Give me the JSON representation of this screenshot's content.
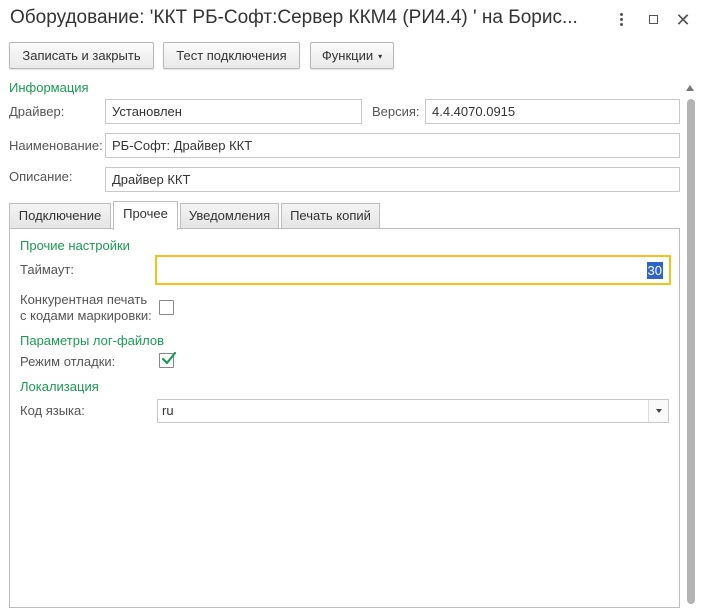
{
  "window": {
    "title": "Оборудование: 'ККТ РБ-Софт:Сервер ККМ4 (РИ4.4) ' на Борис...",
    "menu_icon": "more-vertical-icon",
    "maximize_icon": "maximize-icon",
    "close_icon": "close-icon",
    "close_glyph": "✕"
  },
  "toolbar": {
    "save_close_label": "Записать и закрыть",
    "test_connection_label": "Тест подключения",
    "functions_label": "Функции",
    "functions_caret": "▾"
  },
  "info": {
    "header": "Информация",
    "driver_label": "Драйвер:",
    "driver_value": "Установлен",
    "version_label": "Версия:",
    "version_value": "4.4.4070.0915",
    "name_label": "Наименование:",
    "name_value": "РБ-Софт: Драйвер ККТ",
    "description_label": "Описание:",
    "description_value": "Драйвер ККТ"
  },
  "tabs": [
    {
      "label": "Подключение",
      "active": false
    },
    {
      "label": "Прочее",
      "active": true
    },
    {
      "label": "Уведомления",
      "active": false
    },
    {
      "label": "Печать копий",
      "active": false
    }
  ],
  "other_settings": {
    "header": "Прочие настройки",
    "timeout_label": "Таймаут:",
    "timeout_value": "30",
    "concurrent_print_label_line1": "Конкурентная печать",
    "concurrent_print_label_line2": "с кодами маркировки:",
    "concurrent_print_checked": false
  },
  "log_settings": {
    "header": "Параметры лог-файлов",
    "debug_mode_label": "Режим отладки:",
    "debug_mode_checked": true
  },
  "localization": {
    "header": "Локализация",
    "language_code_label": "Код языка:",
    "language_code_value": "ru"
  },
  "colors": {
    "section_header": "#1a9b53",
    "focus_border": "#f0c419",
    "selection": "#2f66c6",
    "checkmark": "#1a9b53"
  }
}
